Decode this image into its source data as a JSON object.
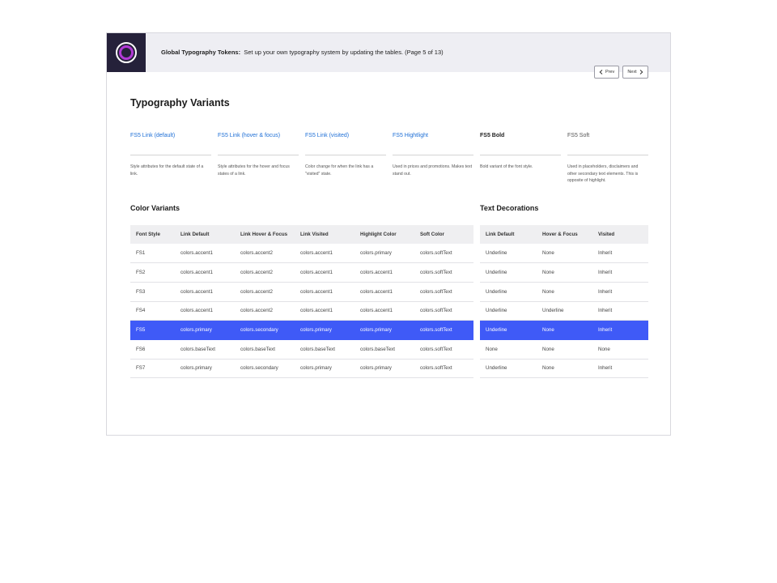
{
  "header": {
    "title_bold": "Global Typography Tokens:",
    "title_rest": "Set up your own typography system by updating the tables. (Page 5 of 13)"
  },
  "pager": {
    "prev_label": "Prev",
    "next_label": "Next"
  },
  "typography_variants": {
    "title": "Typography Variants",
    "items": [
      {
        "name": "FS5 Link (default)",
        "style": "link",
        "description": "Style attributes for the default state of a link."
      },
      {
        "name": "FS5 Link (hover & focus)",
        "style": "link",
        "description": "Style attributes for the hover and focus states of a link."
      },
      {
        "name": "FS5 Link (visited)",
        "style": "link",
        "description": "Color change for when the link has a \"visited\" state."
      },
      {
        "name": "FS5 Hightlight",
        "style": "link",
        "description": "Used in prices and promotions. Makes text stand out."
      },
      {
        "name": "FS5 Bold",
        "style": "bold",
        "description": "Bold variant of the font style."
      },
      {
        "name": "FS5 Soft",
        "style": "soft",
        "description": "Used in placeholders, disclaimers and other secondary text elements. This is opposite of highlight."
      }
    ]
  },
  "color_variants": {
    "title": "Color Variants",
    "columns": [
      "Font Style",
      "Link Default",
      "Link Hover & Focus",
      "Link Visited",
      "Highlight Color",
      "Soft Color"
    ],
    "rows": [
      [
        "FS1",
        "colors.accent1",
        "colors.accent2",
        "colors.accent1",
        "colors.primary",
        "colors.softText"
      ],
      [
        "FS2",
        "colors.accent1",
        "colors.accent2",
        "colors.accent1",
        "colors.accent1",
        "colors.softText"
      ],
      [
        "FS3",
        "colors.accent1",
        "colors.accent2",
        "colors.accent1",
        "colors.accent1",
        "colors.softText"
      ],
      [
        "FS4",
        "colors.accent1",
        "colors.accent2",
        "colors.accent1",
        "colors.accent1",
        "colors.softText"
      ],
      [
        "FS5",
        "colors.primary",
        "colors.secondary",
        "colors.primary",
        "colors.primary",
        "colors.softText"
      ],
      [
        "FS6",
        "colors.baseText",
        "colors.baseText",
        "colors.baseText",
        "colors.baseText",
        "colors.softText"
      ],
      [
        "FS7",
        "colors.primary",
        "colors.secondary",
        "colors.primary",
        "colors.primary",
        "colors.softText"
      ]
    ],
    "highlighted_row": 4
  },
  "text_decorations": {
    "title": "Text Decorations",
    "columns": [
      "Link Default",
      "Hover & Focus",
      "Visited"
    ],
    "rows": [
      [
        "Underline",
        "None",
        "Inherit"
      ],
      [
        "Underline",
        "None",
        "Inherit"
      ],
      [
        "Underline",
        "None",
        "Inherit"
      ],
      [
        "Underline",
        "Underline",
        "Inherit"
      ],
      [
        "Underline",
        "None",
        "Inherit"
      ],
      [
        "None",
        "None",
        "None"
      ],
      [
        "Underline",
        "None",
        "Inherit"
      ]
    ],
    "highlighted_row": 4
  },
  "colors": {
    "highlight_row": "#3f5af7",
    "link": "#1e6fd6",
    "logo_bg": "#25213a",
    "logo_accent": "#b23ad6",
    "header_bg": "#eeeef3"
  }
}
